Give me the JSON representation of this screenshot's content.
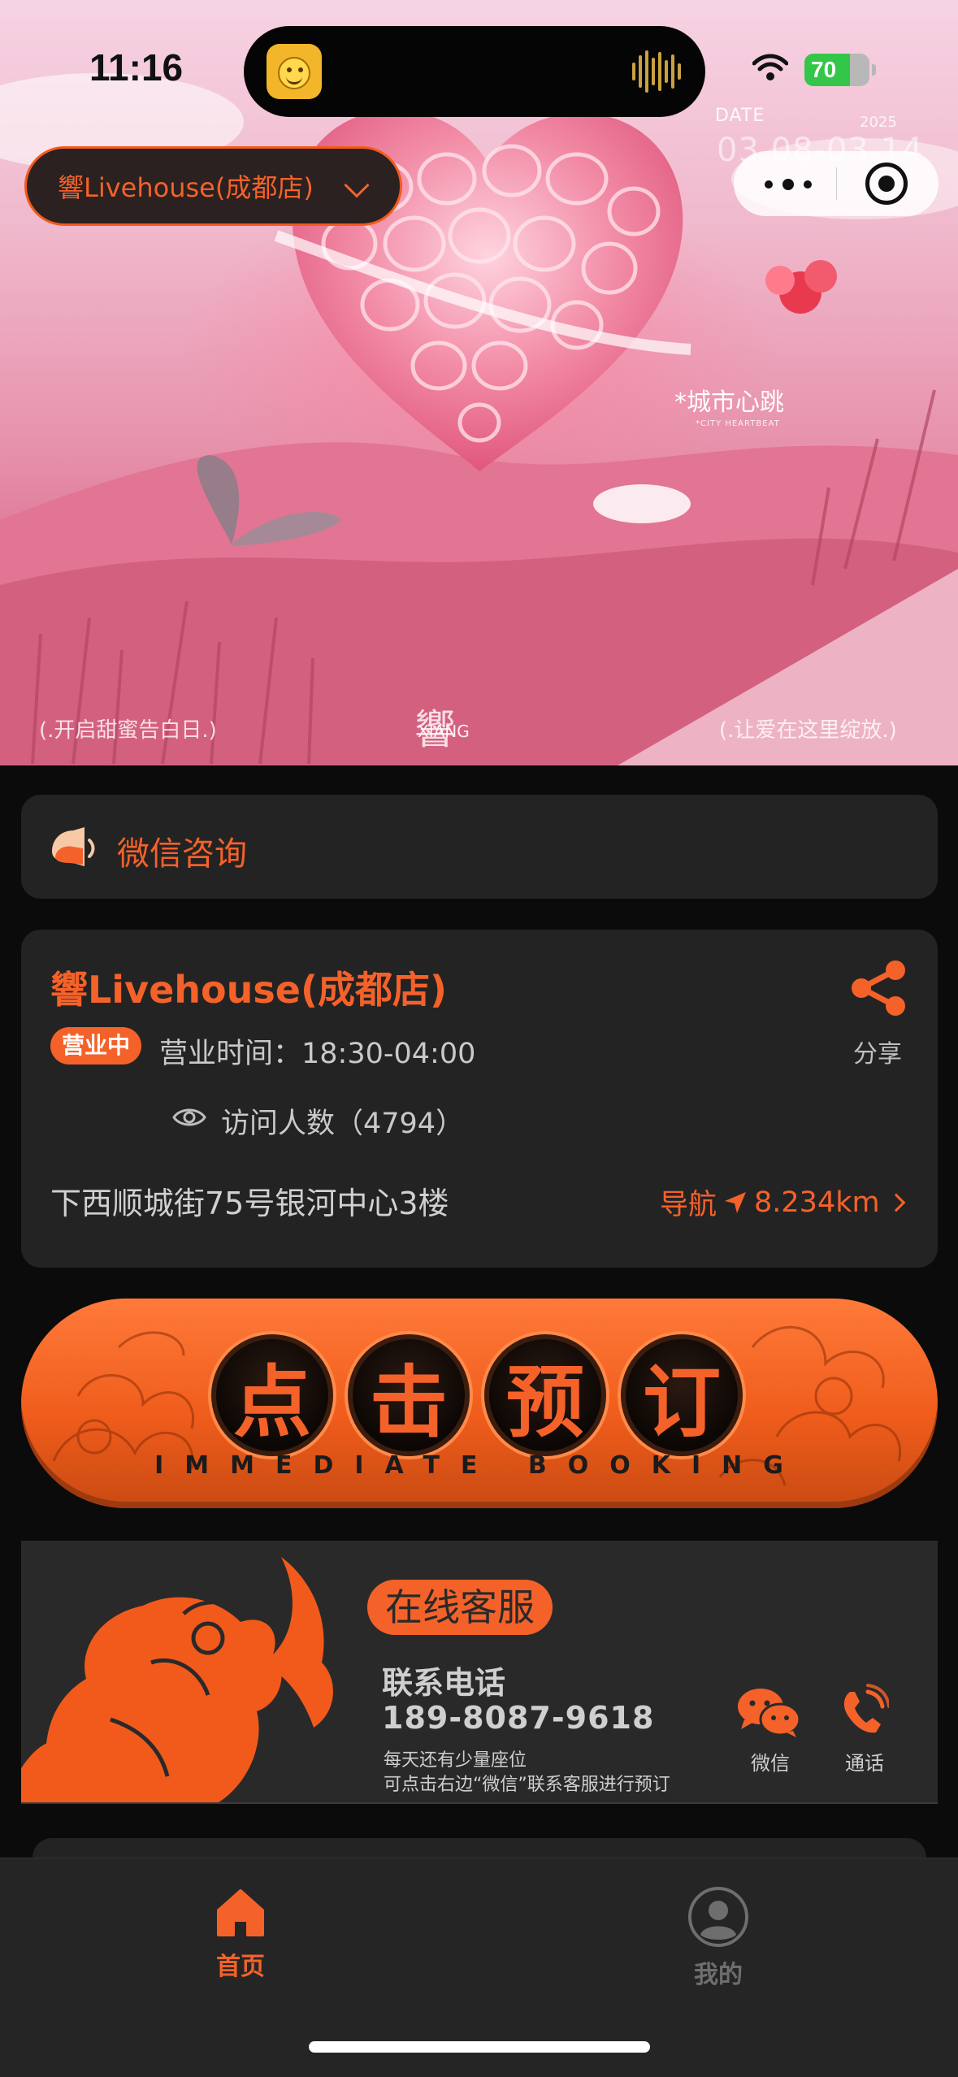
{
  "status_bar": {
    "time": "11:16",
    "battery": "70",
    "battery_level": 0.7
  },
  "hero": {
    "date_label": "DATE",
    "date_year": "2025",
    "date_range": "03.08-03.14",
    "city_title": "*城市心跳",
    "city_subtitle": "*CITY HEARTBEAT",
    "caption_left": "(.开启甜蜜告白日.)",
    "caption_right": "(.让爱在这里绽放.)",
    "logo_text": "響",
    "logo_sub": "XIANG"
  },
  "store_selector": {
    "label": "響Livehouse(成都店)"
  },
  "consult": {
    "label": "微信咨询"
  },
  "venue": {
    "name": "響Livehouse(成都店)",
    "share_label": "分享",
    "status_badge": "营业中",
    "hours": "营业时间：18:30-04:00",
    "visits": "访问人数（4794）",
    "address": "下西顺城街75号银河中心3楼",
    "nav_label": "导航",
    "distance": "8.234km"
  },
  "booking": {
    "chars": [
      "点",
      "击",
      "预",
      "订"
    ],
    "english": "IMMEDIATE BOOKING"
  },
  "service": {
    "title": "在线客服",
    "phone_label": "联系电话",
    "phone": "189-8087-9618",
    "note_1": "每天还有少量座位",
    "note_2": "可点击右边“微信”联系客服进行预订",
    "wechat_label": "微信",
    "call_label": "通话"
  },
  "tabbar": {
    "home_label": "首页",
    "mine_label": "我的"
  },
  "colors": {
    "accent": "#f4622a",
    "card": "#242323",
    "background": "#0c0b0b"
  }
}
